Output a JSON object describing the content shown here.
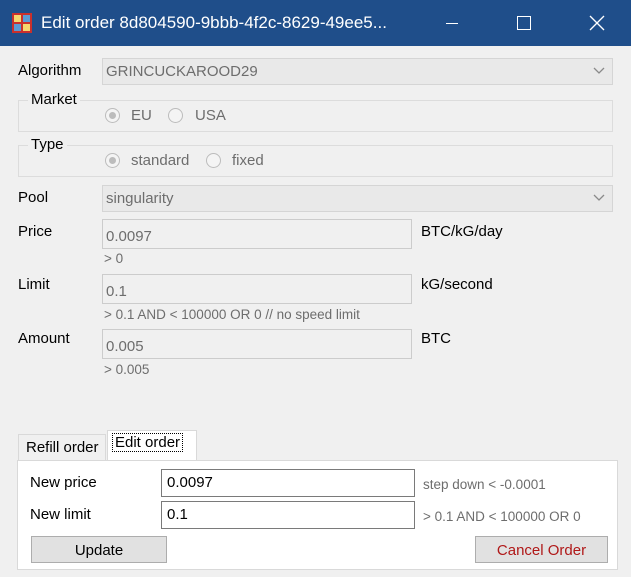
{
  "window": {
    "title": "Edit order 8d804590-9bbb-4f2c-8629-49ee5...",
    "app_icon": "app-grid-icon"
  },
  "form": {
    "algorithm": {
      "label": "Algorithm",
      "value": "GRINCUCKAROOD29"
    },
    "market": {
      "label": "Market",
      "options": [
        "EU",
        "USA"
      ],
      "selected": "EU"
    },
    "type": {
      "label": "Type",
      "options": [
        "standard",
        "fixed"
      ],
      "selected": "standard"
    },
    "pool": {
      "label": "Pool",
      "value": "singularity"
    },
    "price": {
      "label": "Price",
      "value": "0.0097",
      "unit": "BTC/kG/day",
      "hint": "> 0"
    },
    "limit": {
      "label": "Limit",
      "value": "0.1",
      "unit": "kG/second",
      "hint": "> 0.1 AND < 100000 OR 0 // no speed limit"
    },
    "amount": {
      "label": "Amount",
      "value": "0.005",
      "unit": "BTC",
      "hint": "> 0.005"
    }
  },
  "tabs": [
    {
      "label": "Refill order",
      "active": false
    },
    {
      "label": "Edit order",
      "active": true
    }
  ],
  "edit_panel": {
    "new_price_label": "New price",
    "new_price_value": "0.0097",
    "new_price_hint": "step down < -0.0001",
    "new_limit_label": "New limit",
    "new_limit_value": "0.1",
    "new_limit_hint": "> 0.1 AND < 100000 OR 0",
    "update_label": "Update",
    "cancel_label": "Cancel Order"
  },
  "colors": {
    "titlebar": "#1f4e8a",
    "cancel_text": "#b01818"
  }
}
